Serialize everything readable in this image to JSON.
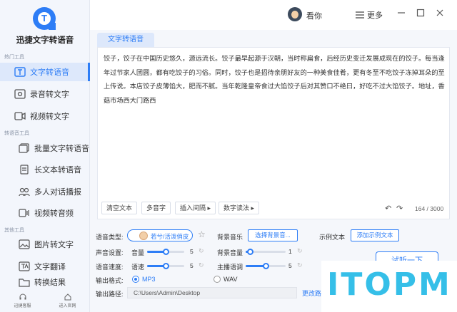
{
  "app": {
    "name": "迅捷文字转语音"
  },
  "sidebar": {
    "sections": [
      {
        "label": "热门工具"
      },
      {
        "label": "转语音工具"
      },
      {
        "label": "其他工具"
      }
    ],
    "items": [
      {
        "label": "文字转语音",
        "icon": "text-to-speech-icon",
        "active": true
      },
      {
        "label": "录音转文字",
        "icon": "recording-to-text-icon"
      },
      {
        "label": "视频转文字",
        "icon": "video-to-text-icon"
      },
      {
        "label": "批量文字转语音",
        "icon": "batch-text-icon"
      },
      {
        "label": "长文本转语音",
        "icon": "long-text-icon"
      },
      {
        "label": "多人对话播报",
        "icon": "multi-dialog-icon"
      },
      {
        "label": "视频转音频",
        "icon": "video-to-audio-icon"
      },
      {
        "label": "图片转文字",
        "icon": "image-to-text-icon"
      },
      {
        "label": "文字翻译",
        "icon": "translate-icon"
      },
      {
        "label": "转换结果",
        "icon": "folder-icon"
      }
    ],
    "bottom": [
      {
        "label": "迅捷客服",
        "icon": "headset-icon"
      },
      {
        "label": "进入官网",
        "icon": "home-icon"
      }
    ]
  },
  "header": {
    "username": "看你",
    "more_label": "更多",
    "icons": [
      "menu-icon",
      "minimize-icon",
      "maximize-icon",
      "close-icon"
    ]
  },
  "tab": {
    "label": "文字转语音"
  },
  "editor": {
    "text": "饺子，饺子在中国历史悠久，源远流长。饺子最早起源于汉朝，当时称扁食，后经历史变迁发展成现在的饺子。每当逢年过节家人团圆，都有吃饺子的习俗。同时，饺子也是招待亲朋好友的一种美食佳肴，更有冬至不吃饺子冻掉耳朵的至上传说。本店饺子皮薄馅大，肥而不腻。当年乾隆皇帝食过大馅饺子后对其赞口不绝曰，好吃不过大馅饺子。地址，香菇市场西大门路西",
    "buttons": [
      "清空文本",
      "多音字",
      "插入间隔 ▸",
      "数字读法 ▸"
    ],
    "counter": "164 / 3000"
  },
  "settings": {
    "voice_type_label": "语音类型:",
    "voice_name": "若兮/活泼俏皮",
    "bg_music_label": "背景音乐",
    "bg_music_button": "选择背景音...",
    "example_label": "示例文本",
    "example_button": "添加示例文本",
    "voice_setting_label": "声音设置:",
    "volume_label": "音量",
    "volume_value": "5",
    "bg_volume_label": "背景音量",
    "bg_volume_value": "1",
    "speed_label": "语音速度:",
    "speed_sub_label": "语速",
    "speed_value": "5",
    "pitch_label": "主播语调",
    "pitch_value": "5",
    "format_label": "输出格式:",
    "format_mp3": "MP3",
    "format_wav": "WAV",
    "path_label": "输出路径:",
    "path_value": "C:\\Users\\Admin\\Desktop",
    "change_dir": "更改路",
    "listen_button": "试听一下",
    "volume_level": 0.5,
    "bg_volume_level": 0.1,
    "speed_level": 0.5,
    "pitch_level": 0.5
  },
  "watermark": {
    "text": "ITOPM"
  },
  "colors": {
    "accent": "#2d7df6",
    "sidebar_bg": "#f3f6fc",
    "watermark": "#35bfe8"
  }
}
